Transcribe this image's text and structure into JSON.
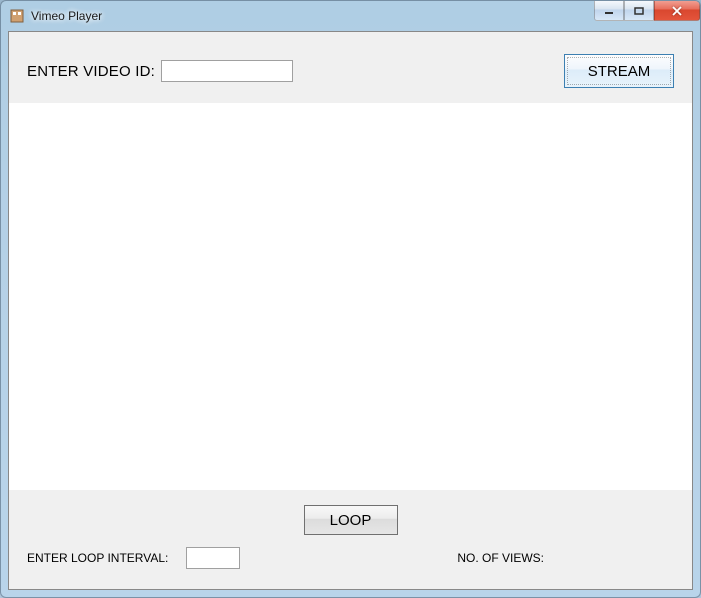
{
  "window": {
    "title": "Vimeo Player"
  },
  "top": {
    "video_id_label": "ENTER VIDEO ID:",
    "video_id_value": "",
    "stream_button_label": "STREAM"
  },
  "loop": {
    "button_label": "LOOP"
  },
  "bottom": {
    "interval_label": "ENTER LOOP INTERVAL:",
    "interval_value": "",
    "views_label": "NO. OF VIEWS:"
  }
}
